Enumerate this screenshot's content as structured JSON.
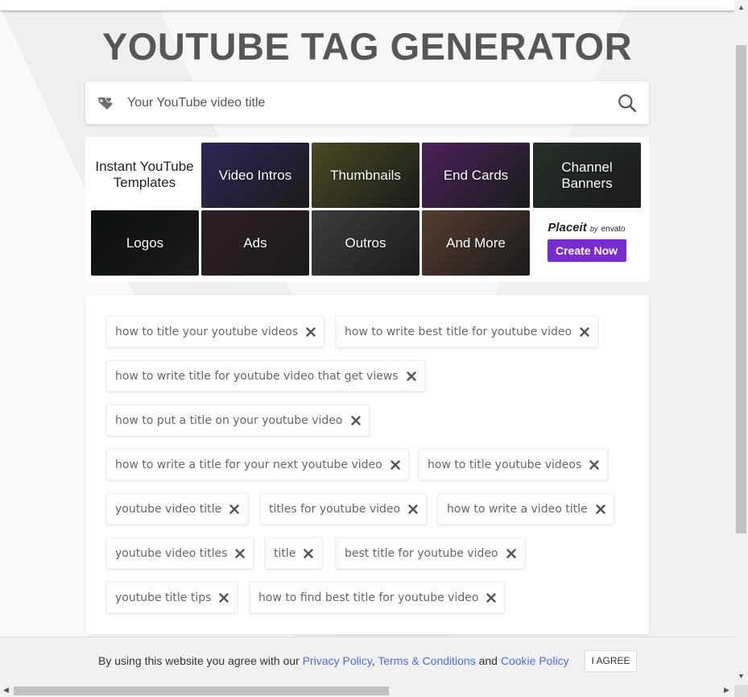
{
  "header": {
    "title": "YOUTUBE TAG GENERATOR"
  },
  "search": {
    "placeholder": "Your YouTube video title",
    "value": ""
  },
  "templates": {
    "intro": "Instant YouTube Templates",
    "tiles": [
      {
        "label": "Video Intros",
        "bg": "#3a2f6b"
      },
      {
        "label": "Thumbnails",
        "bg": "#5b5a2a"
      },
      {
        "label": "End Cards",
        "bg": "#5b2a6e"
      },
      {
        "label": "Channel Banners",
        "bg": "#2e3b32"
      },
      {
        "label": "Logos",
        "bg": "#0f1416"
      },
      {
        "label": "Ads",
        "bg": "#3b2530"
      },
      {
        "label": "Outros",
        "bg": "#4c4c4c"
      },
      {
        "label": "And More",
        "bg": "#6b4a3a"
      }
    ],
    "placeit": {
      "brand": "Placeit",
      "by": "by",
      "partner": "envato",
      "cta": "Create Now"
    }
  },
  "tags": [
    "how to title your youtube videos",
    "how to write best title for youtube video",
    "how to write title for youtube video that get views",
    "how to put a title on your youtube video",
    "how to write a title for your next youtube video",
    "how to title youtube videos",
    "youtube video title",
    "titles for youtube video",
    "how to write a video title",
    "youtube video titles",
    "title",
    "best title for youtube video",
    "youtube title tips",
    "how to find best title for youtube video"
  ],
  "cookie": {
    "text_before": "By using this website you agree with our ",
    "privacy": "Privacy Policy",
    "comma": ",",
    "terms": "Terms & Conditions",
    "and": " and ",
    "cookie_policy": "Cookie Policy",
    "agree": "I AGREE",
    "link_color": "#4a6ee0"
  },
  "accent": "#7a2bd0"
}
